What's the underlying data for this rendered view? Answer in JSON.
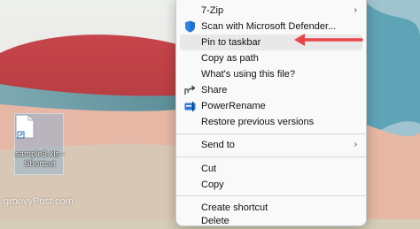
{
  "desktop": {
    "shortcut_label": "sample3.xls - Shortcut",
    "watermark": "groovyPost.com"
  },
  "context_menu": {
    "items": [
      {
        "label": "7-Zip",
        "submenu": true
      },
      {
        "label": "Scan with Microsoft Defender...",
        "icon": "defender-shield-icon"
      },
      {
        "label": "Pin to taskbar"
      },
      {
        "label": "Copy as path"
      },
      {
        "label": "What's using this file?"
      },
      {
        "label": "Share",
        "icon": "share-icon"
      },
      {
        "label": "PowerRename",
        "icon": "powerrename-icon"
      },
      {
        "label": "Restore previous versions"
      },
      {
        "label": "Send to",
        "submenu": true
      },
      {
        "label": "Cut"
      },
      {
        "label": "Copy"
      },
      {
        "label": "Create shortcut"
      },
      {
        "label": "Delete"
      }
    ]
  },
  "annotation": {
    "arrow_color": "#e8444a"
  },
  "colors": {
    "menu_background": "#f9f9f9",
    "defender_blue": "#1f6fd1"
  }
}
